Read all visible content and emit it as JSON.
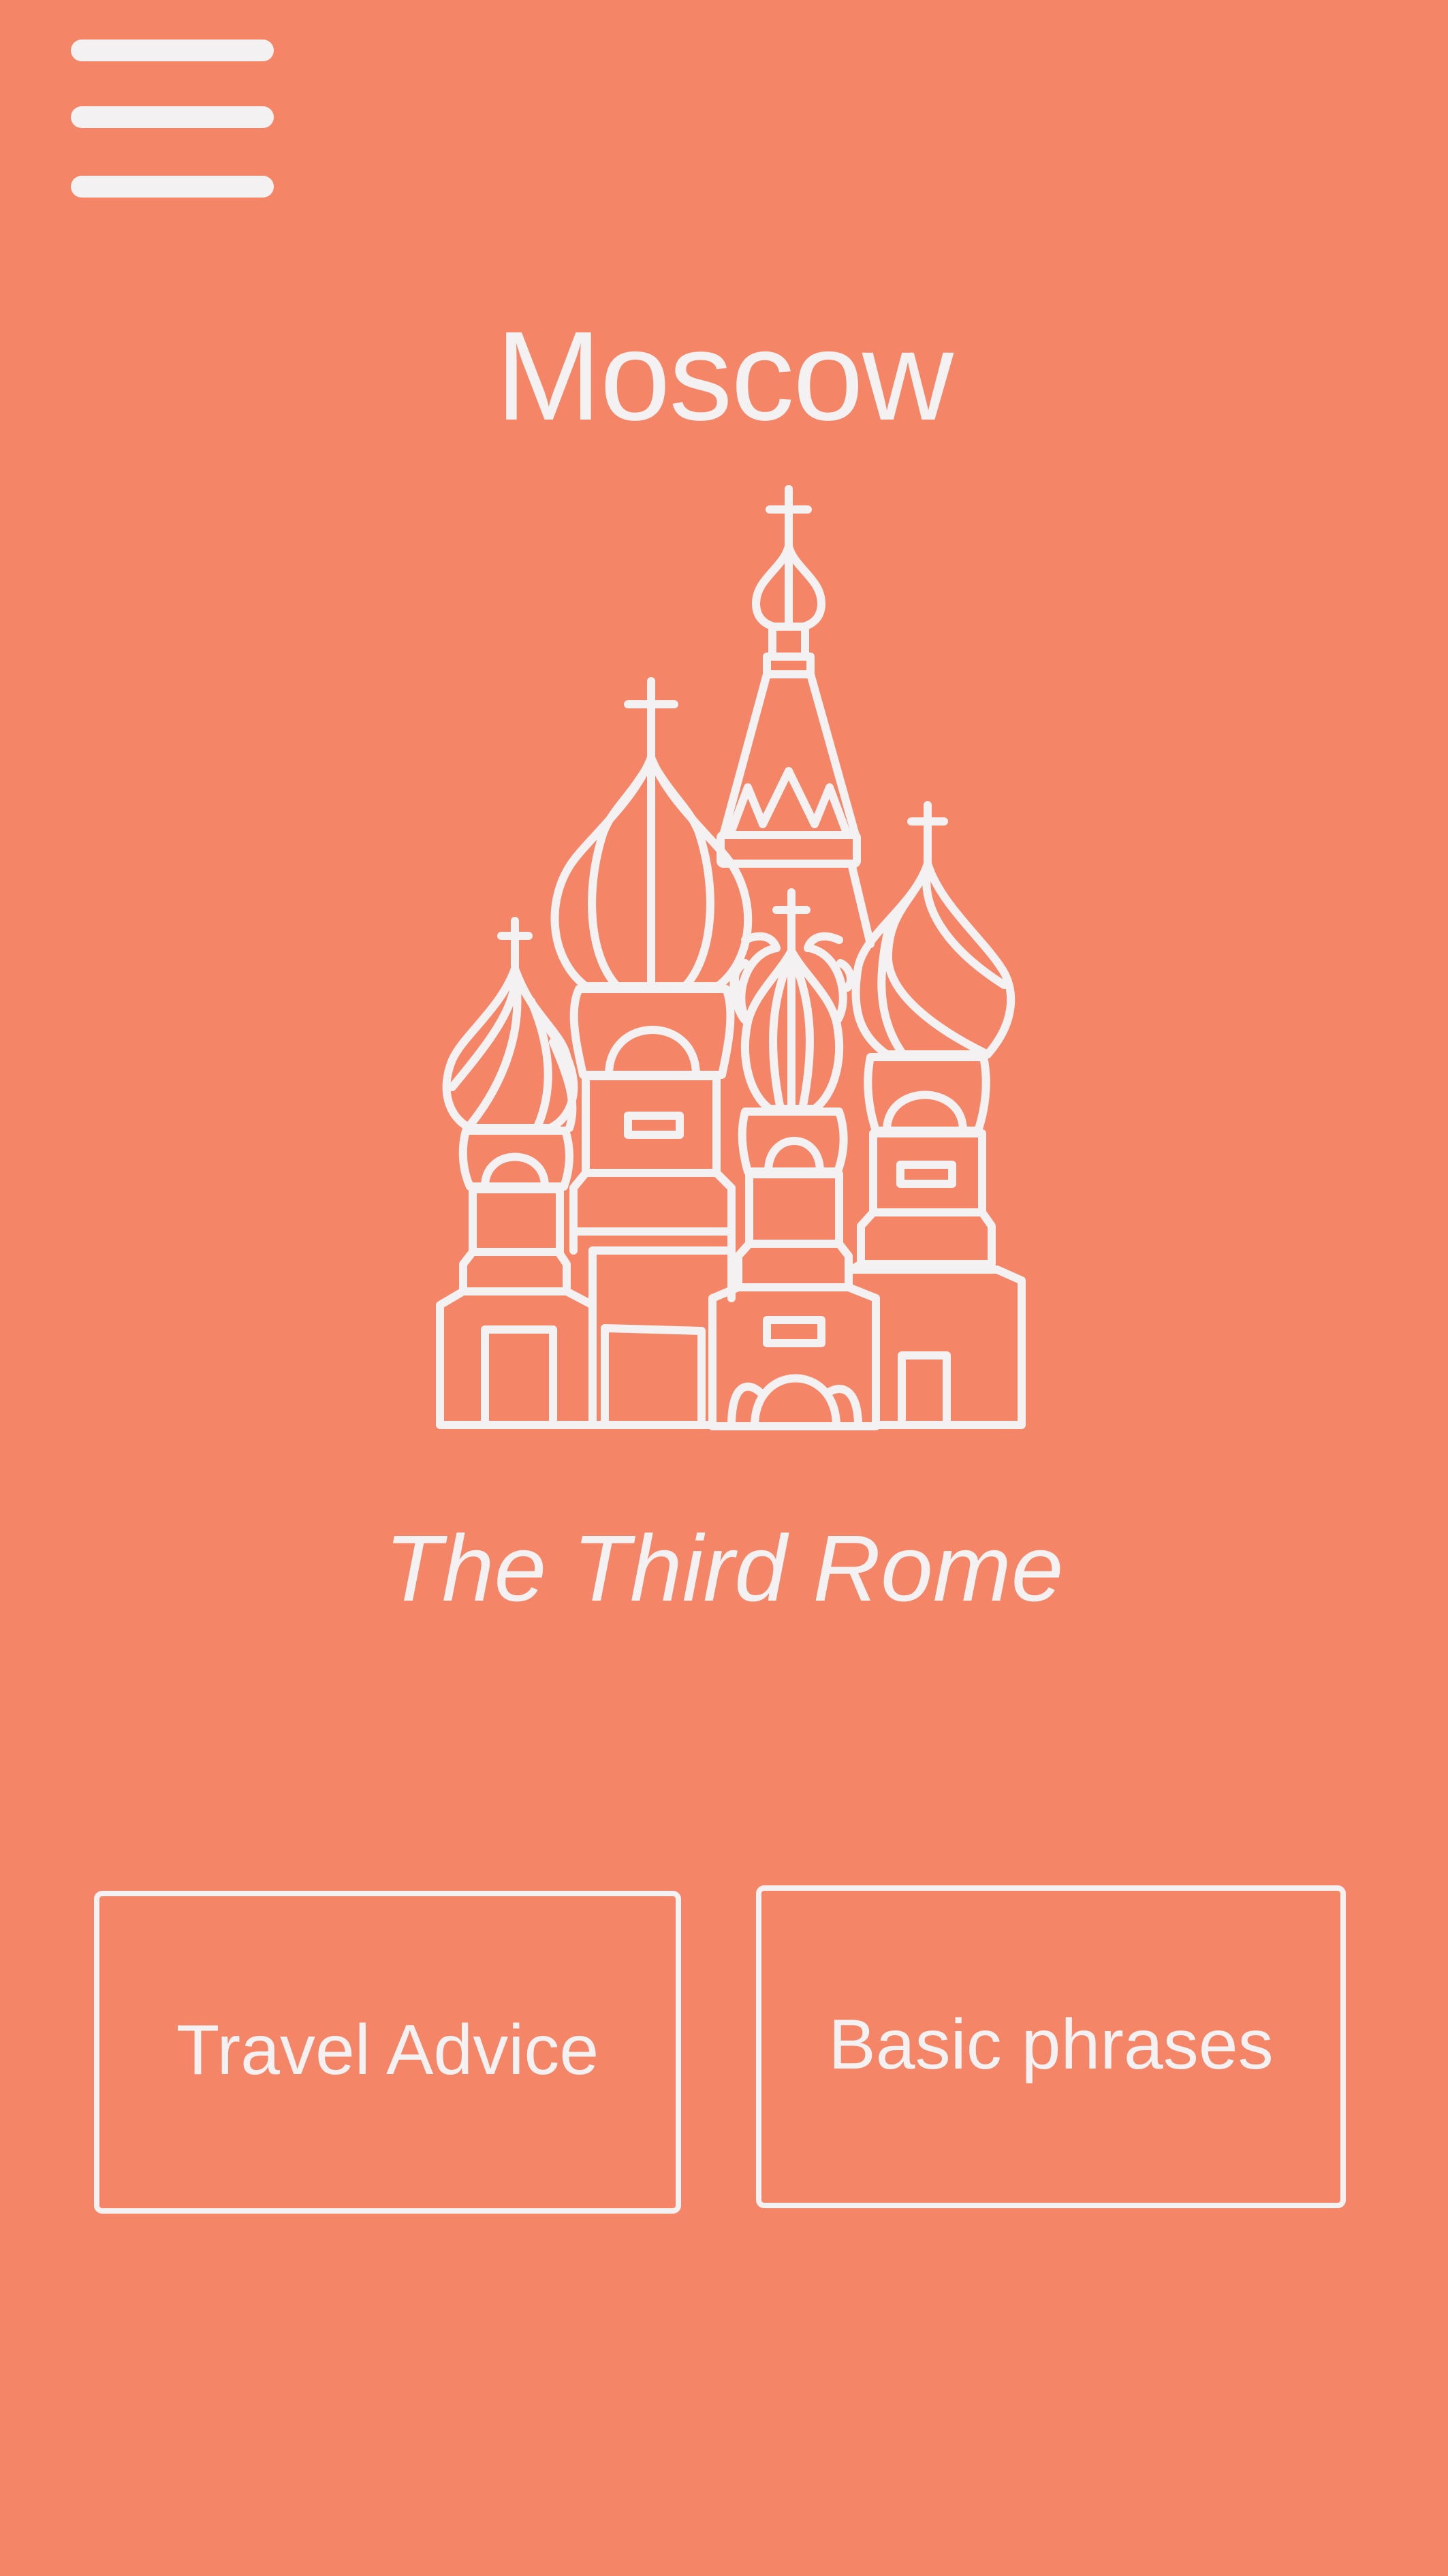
{
  "app": {
    "city": "Moscow",
    "tagline": "The Third Rome",
    "landmark_icon": "cathedral-icon"
  },
  "menu": {
    "icon": "hamburger-menu-icon"
  },
  "actions": {
    "travel_advice_label": "Travel Advice",
    "basic_phrases_label": "Basic phrases"
  },
  "theme": {
    "background": "#F48667",
    "foreground": "#F4F1F3"
  }
}
